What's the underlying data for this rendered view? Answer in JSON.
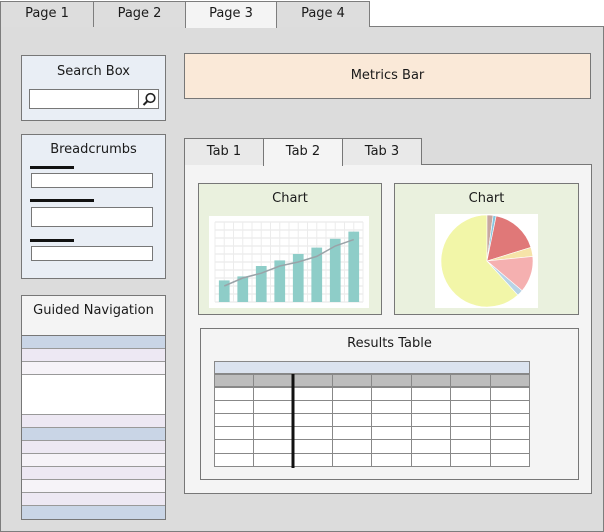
{
  "page_tabs": [
    {
      "label": "Page 1"
    },
    {
      "label": "Page 2"
    },
    {
      "label": "Page 3"
    },
    {
      "label": "Page 4"
    }
  ],
  "search": {
    "title": "Search Box"
  },
  "breadcrumbs": {
    "title": "Breadcrumbs"
  },
  "guided_navigation": {
    "title": "Guided Navigation"
  },
  "metrics": {
    "label": "Metrics Bar"
  },
  "inner_tabs": [
    {
      "label": "Tab 1"
    },
    {
      "label": "Tab 2"
    },
    {
      "label": "Tab 3"
    }
  ],
  "charts": {
    "left_title": "Chart",
    "right_title": "Chart"
  },
  "results": {
    "title": "Results Table"
  },
  "chart_data": [
    {
      "type": "bar",
      "bar_color": "#8ecdc8",
      "line_color": "#9aa3a8",
      "values": [
        27,
        32,
        45,
        52,
        60,
        68,
        79,
        88
      ],
      "line": [
        20,
        30,
        36,
        45,
        50,
        57,
        70,
        78
      ],
      "ylim": [
        0,
        100
      ],
      "grid": true
    },
    {
      "type": "pie",
      "slices": [
        {
          "value": 58,
          "color": "#f2f6a8"
        },
        {
          "value": 2,
          "color": "#c8a8a0"
        },
        {
          "value": 1,
          "color": "#86c6e0"
        },
        {
          "value": 16,
          "color": "#e07878"
        },
        {
          "value": 3,
          "color": "#f6e3a8"
        },
        {
          "value": 12,
          "color": "#f5b0b0"
        },
        {
          "value": 2,
          "color": "#b8d3e6"
        }
      ]
    }
  ]
}
